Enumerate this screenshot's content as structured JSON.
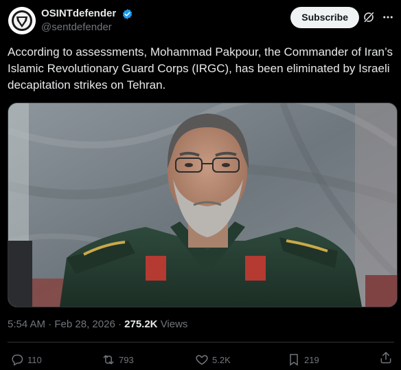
{
  "author": {
    "display_name": "OSINTdefender",
    "handle": "@sentdefender",
    "verified": true
  },
  "header": {
    "subscribe_label": "Subscribe",
    "icons": [
      "grok-icon",
      "more-icon"
    ]
  },
  "tweet": {
    "text": "According to assessments, Mohammad Pakpour, the Commander of Iran’s Islamic Revolutionary Guard Corps (IRGC), has been eliminated by Israeli decapitation strikes on Tehran."
  },
  "meta": {
    "time": "5:54 AM",
    "date": "Feb 28, 2026",
    "views_count": "275.2K",
    "views_label": "Views"
  },
  "actions": {
    "replies": "110",
    "reposts": "793",
    "likes": "5.2K",
    "bookmarks": "219"
  },
  "colors": {
    "background": "#000000",
    "text": "#e7e9ea",
    "muted": "#71767b",
    "verified": "#1d9bf0",
    "subscribe_bg": "#eff3f4"
  }
}
